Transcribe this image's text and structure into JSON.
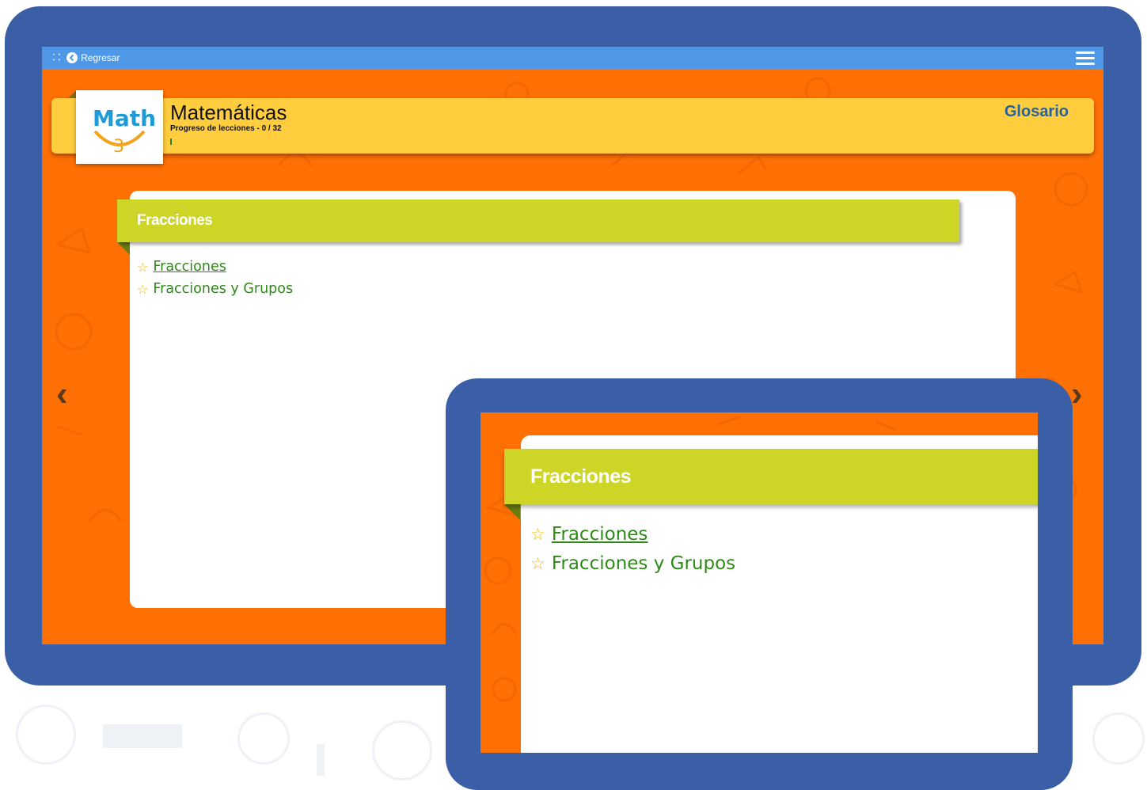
{
  "topbar": {
    "back_label": "Regresar"
  },
  "course": {
    "title": "Matemáticas",
    "progress_text": "Progreso de lecciones - 0 / 32",
    "logo_text": "Math",
    "logo_number": "3",
    "glossary_label": "Glosario"
  },
  "unit": {
    "title": "Fracciones",
    "lessons": [
      {
        "label": "Fracciones",
        "linked": true
      },
      {
        "label": "Fracciones y Grupos",
        "linked": false
      }
    ]
  },
  "nav": {
    "prev_symbol": "‹",
    "next_symbol": "›"
  },
  "icons": {
    "collapse": "collapse-icon",
    "back": "back-arrow-icon",
    "menu": "hamburger-menu-icon",
    "star": "star-outline-icon"
  },
  "colors": {
    "frame": "#3b5fa6",
    "topbar": "#4f98e8",
    "background": "#ff7004",
    "header": "#ffcd3d",
    "unit_banner": "#cdd527",
    "lesson_text": "#2d8a17",
    "glossary": "#27619c",
    "star": "#f2b705"
  }
}
